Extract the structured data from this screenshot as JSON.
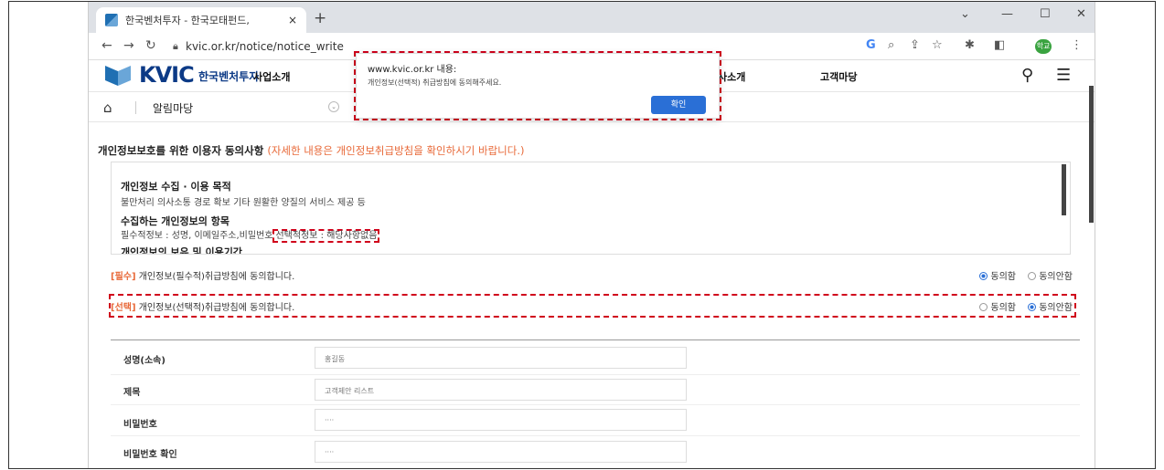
{
  "browser": {
    "tab_title": "한국벤처투자 - 한국모태펀드,",
    "tab_close": "×",
    "new_tab": "+",
    "url": "kvic.or.kr/notice/notice_write",
    "profile_label": "학교"
  },
  "site": {
    "logo_text": "KVIC",
    "logo_kr": "한국벤처투자",
    "nav_items": [
      "사업소개",
      "사소개",
      "고객마당"
    ]
  },
  "subnav": {
    "crumb": "알림마당"
  },
  "privacy": {
    "title": "개인정보보호를 위한 이용자 동의사항",
    "note": "(자세한 내용은 개인정보취급방침을 확인하시기 바랍니다.)",
    "h1": "개인정보 수집 · 이용 목적",
    "t1": "불만처리 의사소통 경로 확보 기타 원활한 양질의 서비스 제공 등",
    "h2": "수집하는 개인정보의 항목",
    "t2a": "필수적정보 : 성명, 이메일주소,비밀번호",
    "t2b": "선택적정보 : 해당사항없음",
    "h3": "개인정보의 보유 및 이용기간"
  },
  "consent": {
    "required_tag": "[필수]",
    "required_text": "개인정보(필수적)취급방침에 동의합니다.",
    "optional_tag": "[선택]",
    "optional_text": "개인정보(선택적)취급방침에 동의합니다.",
    "agree": "동의함",
    "disagree": "동의안함"
  },
  "form": {
    "name_label": "성명(소속)",
    "name_value": "홍길동",
    "subject_label": "제목",
    "subject_value": "고객제안 리스트",
    "pw_label": "비밀번호",
    "pw_value": "····",
    "pw_confirm_label": "비밀번호 확인",
    "pw_confirm_value": "····"
  },
  "alert": {
    "title": "www.kvic.or.kr 내용:",
    "message": "개인정보(선택적) 취급방침에 동의해주세요.",
    "ok": "확인"
  },
  "colors": {
    "brand": "#0c3a86",
    "accent": "#e86a3a",
    "button": "#2a6fd6",
    "highlight": "#d0021b"
  }
}
